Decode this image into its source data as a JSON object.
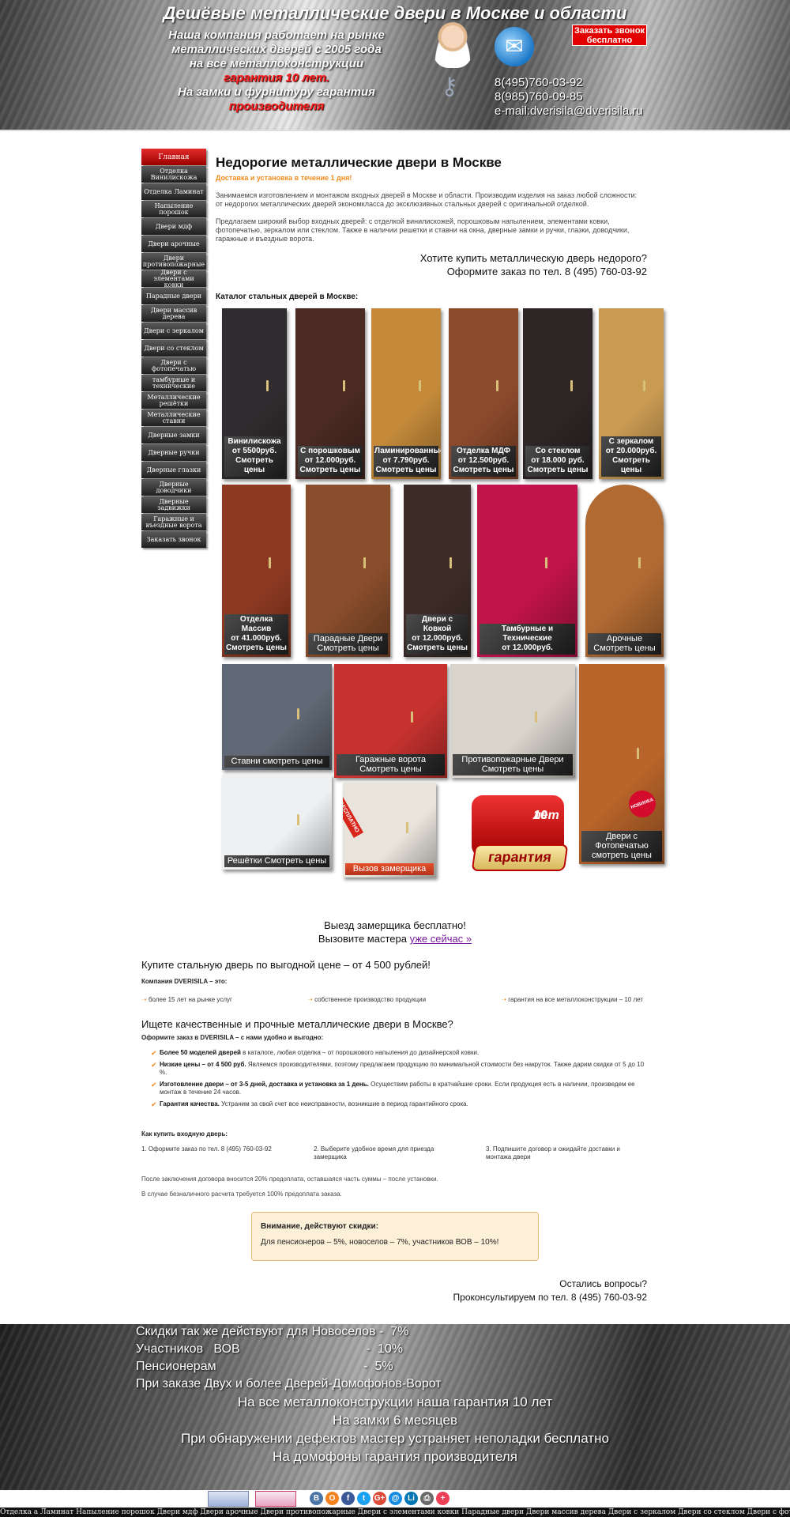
{
  "header": {
    "title": "Дешёвые металлические двери в Москве и области",
    "slogan_lines": [
      "Наша компания работает на рынке",
      "металлических дверей  с 2005 года",
      "на все металлоконструкции"
    ],
    "guarantee": "гарантия 10 лет.",
    "locks_line": "На замки и фурнитуру гарантия",
    "manufacturer": "производителя",
    "callback_line1": "Заказать звонок",
    "callback_line2": "бесплатно",
    "phone1": "8(495)760-03-92",
    "phone2": "8(985)760-09-85",
    "email": "e-mail:dverisila@dverisila.ru"
  },
  "sidebar": {
    "items": [
      "Главная",
      "Отделка Винилискожа",
      "Отделка Ламинат",
      "Напыление порошок",
      "Двери мдф",
      "Двери арочные",
      "Двери противопожарные",
      "Двери с элементами ковки",
      "Парадные двери",
      "Двери массив дерева",
      "Двери с зеркалом",
      "Двери со стеклом",
      "Двери с фотопечатью",
      "тамбурные и технические",
      "Металлические решётки",
      "Металлические ставни",
      "Дверные замки",
      "Дверные ручки",
      "Дверные глазки",
      "Дверные доводчики",
      "Дверные задвижки",
      "Гаражные и въездные ворота",
      "Заказать звонок"
    ]
  },
  "main": {
    "title": "Недорогие металлические двери в Москве",
    "delivery": "Доставка и установка в течение 1 дня!",
    "intro1": "Занимаемся изготовлением и монтажом входных дверей в Москве и области. Производим изделия на заказ любой сложности: от недорогих металлических дверей экономкласса до эксклюзивных стальных дверей с оригинальной отделкой.",
    "intro2": "Предлагаем широкий выбор входных дверей: с отделкой винилискожей, порошковым напылением, элементами ковки, фотопечатью, зеркалом или стеклом. Также в наличии решетки и ставни на окна, дверные замки и ручки, глазки, доводчики, гаражные и въездные ворота.",
    "cta_line1": "Хотите купить металлическую дверь недорого?",
    "cta_line2": "Оформите заказ по тел. 8 (495) 760-03-92",
    "catalog_title": "Каталог стальных дверей в Москве:"
  },
  "catalog": [
    {
      "caption": "Винилискожа\nот 5500руб.\nСмотреть цены",
      "color": "#2f2b2e"
    },
    {
      "caption": "С порошковым\nот 12.000руб.\nСмотреть цены",
      "color": "#4a2a22"
    },
    {
      "caption": "Ламинированные\nот 7.790руб.\nСмотреть цены",
      "color": "#c48a3a"
    },
    {
      "caption": "Отделка МДФ\nот 12.500руб.\nСмотреть цены",
      "color": "#8c4a2c"
    },
    {
      "caption": "Со стеклом\nот 18.000 руб.\nСмотреть цены",
      "color": "#2e2626"
    },
    {
      "caption": "С зеркалом\nот 20.000руб.\nСмотреть цены",
      "color": "#c99a52"
    },
    {
      "caption": "Отделка Массив\nот 41.000руб.\nСмотреть цены",
      "color": "#8e3a22"
    },
    {
      "caption": "Парадные Двери\nСмотреть цены",
      "color": "#8a4e2c"
    },
    {
      "caption": "Двери с Ковкой\nот 12.000руб.\nСмотреть цены",
      "color": "#3d2c27"
    },
    {
      "caption": "Тамбурные и\nТехнические\nот 12.000руб.",
      "color": "#c0144a"
    },
    {
      "caption": "Арочные\nСмотреть цены",
      "color": "#b06a32"
    },
    {
      "caption": "Ставни смотреть цены",
      "color": "#5f6874"
    },
    {
      "caption": "Гаражные ворота\nСмотреть цены",
      "color": "#c7322f"
    },
    {
      "caption": "Противопожарные  Двери\nСмотреть цены",
      "color": "#d8d4cc"
    },
    {
      "caption": "Двери с\nФотопечатью\nсмотреть цены",
      "color": "#b8642a"
    },
    {
      "caption": "Решётки Смотреть цены",
      "color": "#eef0f2"
    },
    {
      "caption": "Вызов замерщика",
      "color": "#e8e4dc"
    }
  ],
  "badges": {
    "free_ribbon": "БЕСПЛАТНО",
    "novelty": "НОВИНКА",
    "sign_number": "10",
    "sign_years": "лет",
    "sign_word": "гарантия"
  },
  "visit": {
    "line1": "Выезд замерщика бесплатно!",
    "line2_prefix": "Вызовите мастера ",
    "line2_link": "уже сейчас »"
  },
  "about": {
    "heading": "Купите стальную дверь по выгодной цене – от 4 500 рублей!",
    "company": "Компания DVERISILA – это:",
    "perks": [
      "более 15 лет на рынке услуг",
      "собственное производство продукции",
      "гарантия на все металлоконструкции – 10 лет"
    ]
  },
  "why": {
    "heading": "Ищете качественные и прочные металлические двери в Москве?",
    "sub": "Оформите заказ в DVERISILA – с нами удобно и выгодно:",
    "items": [
      {
        "bold": "Более 50 моделей дверей",
        "text": " в каталоге, любая отделка – от порошкового напыления до дизайнерской ковки."
      },
      {
        "bold": "Низкие цены – от 4 500 руб.",
        "text": " Являемся производителями, поэтому предлагаем продукцию по минимальной стоимости без накруток. Также дарим скидки от 5 до 10 %."
      },
      {
        "bold": "Изготовление двери – от 3-5 дней, доставка и установка за 1 день.",
        "text": " Осуществим работы в кратчайшие сроки. Если продукция есть в наличии, произведем ее монтаж в течение 24 часов."
      },
      {
        "bold": "Гарантия качества.",
        "text": " Устраним за свой счет все неисправности, возникшие в период гарантийного срока."
      }
    ]
  },
  "howto": {
    "heading": "Как купить входную дверь:",
    "steps": [
      "1. Оформите заказ по тел. 8 (495) 760-03-92",
      "2. Выберите удобное время для приезда замерщика",
      "3. Подпишите договор и ожидайте доставки и монтажа двери"
    ],
    "note1": "После заключения договора вносится 20% предоплата, оставшаяся часть суммы – после установки.",
    "note2": "В случае безналичного расчета требуется 100% предоплата заказа."
  },
  "discount": {
    "title": "Внимание, действуют скидки:",
    "text": "Для пенсионеров – 5%, новоселов – 7%, участников ВОВ – 10%!"
  },
  "questions": {
    "line1": "Остались вопросы?",
    "line2": "Проконсультируем по тел. 8 (495) 760-03-92"
  },
  "footer": {
    "lines": [
      "Скидки так же действуют для Новоселов -  7%",
      "Участников   ВОВ                                    -  10%",
      "Пенсионерам                                          -  5%",
      "При заказе Двух и более Дверей-Домофонов-Ворот"
    ],
    "center_lines": [
      "На все металлоконструкции наша гарантия 10 лет",
      "На замки 6 месяцев",
      "При обнаружении дефектов мастер устраняет неполадки бесплатно",
      "На домофоны гарантия производителя"
    ]
  },
  "share_icons": [
    "В",
    "О",
    "f",
    "t",
    "G+",
    "@",
    "Li",
    "⎙",
    "+"
  ],
  "share_colors": [
    "#4a76a8",
    "#f58220",
    "#3b5998",
    "#1da1f2",
    "#dd4b39",
    "#168de2",
    "#0077b5",
    "#6a6a6a",
    "#ee4056"
  ],
  "ticker": "Отделка а Ламинат Напыление порошок Двери мдф Двери арочные Двери противопожарные Двери с элементами ковки Парадные двери Двери массив дерева Двери с зеркалом Двери со стеклом Двери с фотопечатью тамбурные и технические Металлические решётки Металлические ставни Двери"
}
